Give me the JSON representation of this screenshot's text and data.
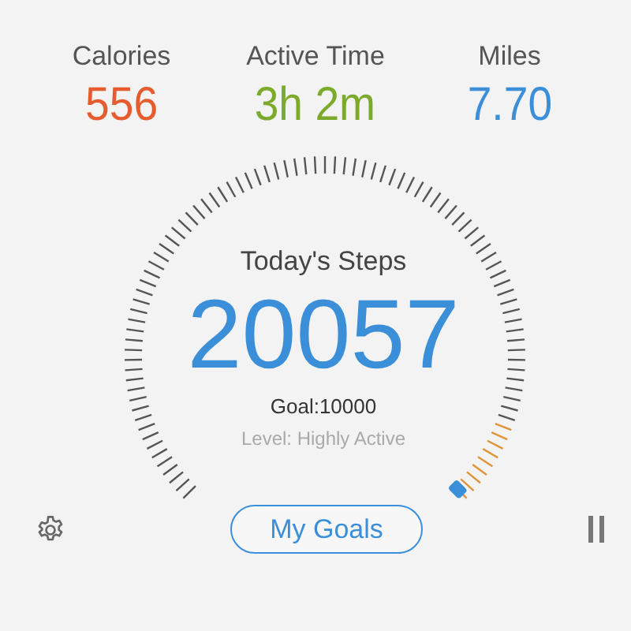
{
  "stats": [
    {
      "label": "Calories",
      "value": "556",
      "color": "#e65c2e"
    },
    {
      "label": "Active Time",
      "value": "3h 2m",
      "color": "#7cab2c"
    },
    {
      "label": "Miles",
      "value": "7.70",
      "color": "#3b8fd9"
    }
  ],
  "steps": {
    "title": "Today's Steps",
    "count": "20057",
    "goal": "Goal:10000",
    "level_text": "Level: Highly Active"
  },
  "goals_button": "My Goals"
}
